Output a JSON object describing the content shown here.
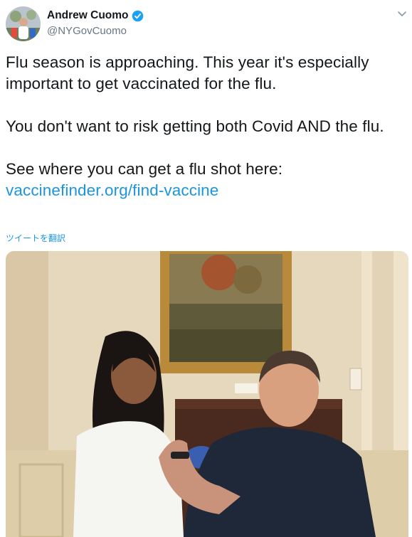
{
  "author": {
    "display_name": "Andrew Cuomo",
    "handle": "@NYGovCuomo",
    "verified": true
  },
  "tweet": {
    "paragraphs": [
      "Flu season is approaching. This year it's especially important to get vaccinated for the flu.",
      "You don't want to risk getting both Covid AND the flu.",
      "See where you can get a flu shot here:"
    ],
    "link_text": "vaccinefinder.org/find-vaccine",
    "translate_label": "ツイートを翻訳"
  },
  "icons": {
    "verified": "verified-badge-icon",
    "menu": "chevron-down-icon"
  },
  "colors": {
    "link": "#1b95e0",
    "verified": "#1da1f2",
    "secondary_text": "#657786"
  }
}
